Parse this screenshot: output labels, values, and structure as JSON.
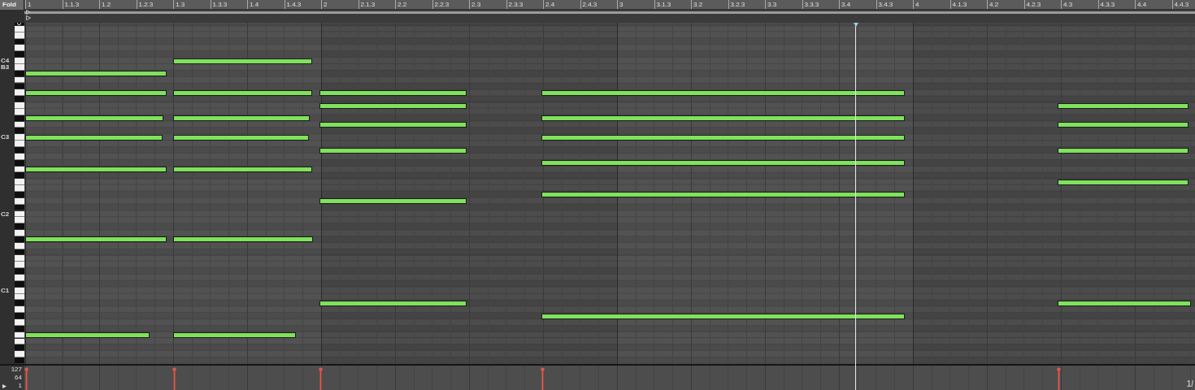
{
  "fold_button": {
    "label": "Fold"
  },
  "ruler": [
    "1",
    "1.1.3",
    "1.2",
    "1.2.3",
    "1.3",
    "1.3.3",
    "1.4",
    "1.4.3",
    "2",
    "2.1.3",
    "2.2",
    "2.2.3",
    "2.3",
    "2.3.3",
    "2.4",
    "2.4.3",
    "3",
    "3.1.3",
    "3.2",
    "3.2.3",
    "3.3",
    "3.3.3",
    "3.4",
    "3.4.3",
    "4",
    "4.1.3",
    "4.2",
    "4.2.3",
    "4.3",
    "4.3.3",
    "4.4",
    "4.4.3"
  ],
  "key_labels": [
    "C4",
    "B3",
    "C3",
    "C2",
    "C1"
  ],
  "velocity": {
    "scale": [
      "127",
      "64",
      "1"
    ]
  },
  "corner_text": "1/"
}
